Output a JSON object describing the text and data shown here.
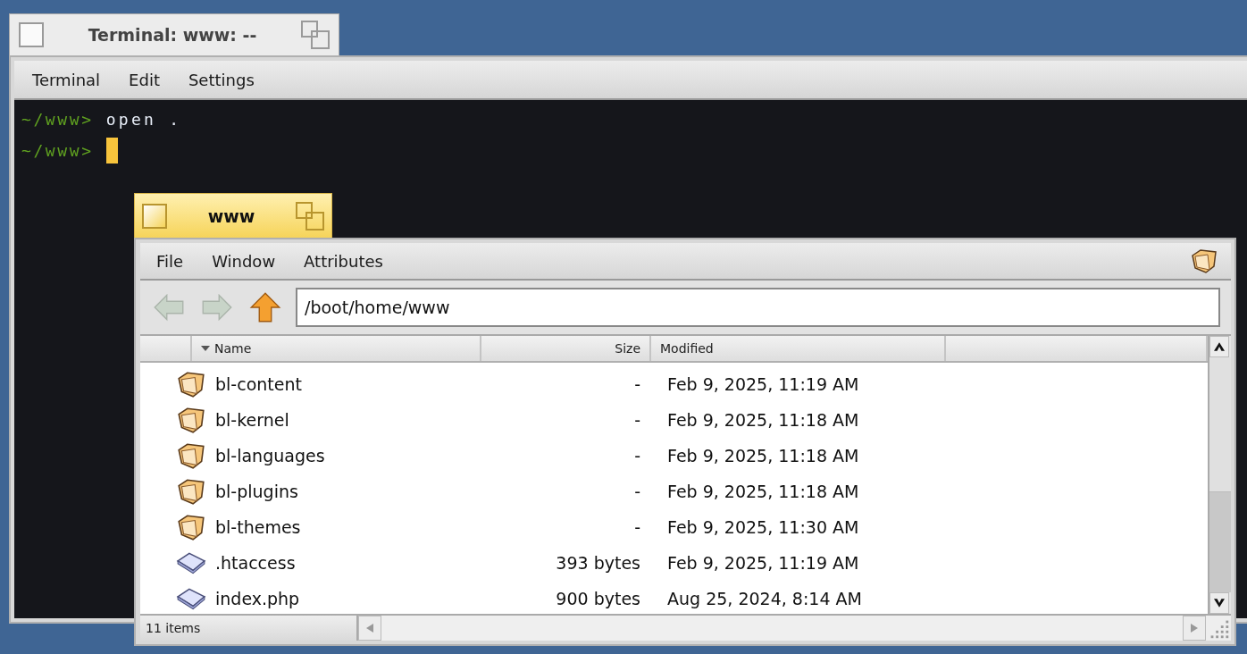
{
  "terminal": {
    "title": "Terminal: www: --",
    "active": false,
    "menu": [
      "Terminal",
      "Edit",
      "Settings"
    ],
    "lines": [
      {
        "prompt": "~/www>",
        "command": "open .",
        "cursor": false
      },
      {
        "prompt": "~/www>",
        "cursor": true
      }
    ]
  },
  "tracker": {
    "title": "www",
    "active": true,
    "menu": [
      "File",
      "Window",
      "Attributes"
    ],
    "nav": [
      {
        "kind": "back",
        "disabled": true
      },
      {
        "kind": "forward",
        "disabled": true
      },
      {
        "kind": "up",
        "disabled": false
      }
    ],
    "path": "/boot/home/www",
    "columns": [
      {
        "label": "Name",
        "sorted": true
      },
      {
        "label": "Size",
        "sorted": false
      },
      {
        "label": "Modified",
        "sorted": false
      }
    ],
    "rows": [
      {
        "kind": "folder",
        "name": "bl-content",
        "size": "-",
        "modified": "Feb 9, 2025, 11:19 AM"
      },
      {
        "kind": "folder",
        "name": "bl-kernel",
        "size": "-",
        "modified": "Feb 9, 2025, 11:18 AM"
      },
      {
        "kind": "folder",
        "name": "bl-languages",
        "size": "-",
        "modified": "Feb 9, 2025, 11:18 AM"
      },
      {
        "kind": "folder",
        "name": "bl-plugins",
        "size": "-",
        "modified": "Feb 9, 2025, 11:18 AM"
      },
      {
        "kind": "folder",
        "name": "bl-themes",
        "size": "-",
        "modified": "Feb 9, 2025, 11:30 AM"
      },
      {
        "kind": "file",
        "name": ".htaccess",
        "size": "393 bytes",
        "modified": "Feb 9, 2025, 11:19 AM"
      },
      {
        "kind": "file",
        "name": "index.php",
        "size": "900 bytes",
        "modified": "Aug 25, 2024, 8:14 AM"
      }
    ],
    "status": "11 items"
  }
}
